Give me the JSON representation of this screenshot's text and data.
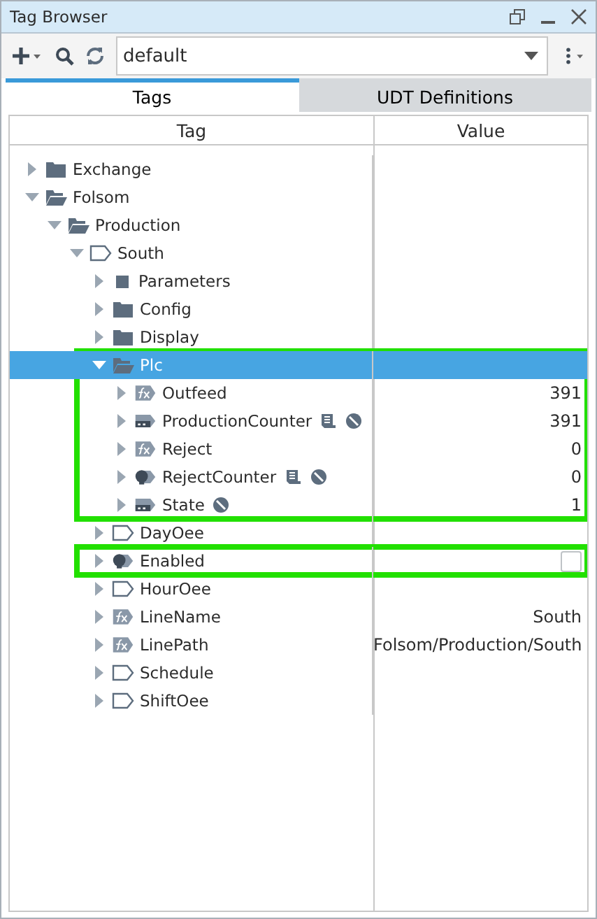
{
  "window": {
    "title": "Tag Browser"
  },
  "toolbar": {
    "provider": "default"
  },
  "tabs": [
    {
      "label": "Tags",
      "selected": true
    },
    {
      "label": "UDT Definitions",
      "selected": false
    }
  ],
  "table": {
    "columns": [
      "Tag",
      "Value"
    ],
    "tree": [
      {
        "name": "Exchange",
        "kind": "folder",
        "expanded": false,
        "selected": false
      },
      {
        "name": "Folsom",
        "kind": "folder",
        "expanded": true,
        "selected": false,
        "children": [
          {
            "name": "Production",
            "kind": "folder",
            "expanded": true,
            "selected": false,
            "children": [
              {
                "name": "South",
                "kind": "udt",
                "expanded": true,
                "selected": false,
                "children": [
                  {
                    "name": "Parameters",
                    "kind": "params",
                    "expanded": false,
                    "selected": false
                  },
                  {
                    "name": "Config",
                    "kind": "folder",
                    "expanded": false,
                    "selected": false
                  },
                  {
                    "name": "Display",
                    "kind": "folder",
                    "expanded": false,
                    "selected": false
                  },
                  {
                    "name": "Plc",
                    "kind": "folder",
                    "expanded": true,
                    "selected": true,
                    "highlighted": true,
                    "children": [
                      {
                        "name": "Outfeed",
                        "kind": "expression",
                        "expanded": false,
                        "selected": false,
                        "value": "391"
                      },
                      {
                        "name": "ProductionCounter",
                        "kind": "opc",
                        "expanded": false,
                        "selected": false,
                        "value": "391",
                        "badges": [
                          {
                            "kind": "doc"
                          },
                          {
                            "kind": "dial"
                          }
                        ]
                      },
                      {
                        "name": "Reject",
                        "kind": "expression",
                        "expanded": false,
                        "selected": false,
                        "value": "0"
                      },
                      {
                        "name": "RejectCounter",
                        "kind": "query",
                        "expanded": false,
                        "selected": false,
                        "value": "0",
                        "badges": [
                          {
                            "kind": "doc"
                          },
                          {
                            "kind": "dial"
                          }
                        ]
                      },
                      {
                        "name": "State",
                        "kind": "opc",
                        "expanded": false,
                        "selected": false,
                        "value": "1",
                        "badges": [
                          {
                            "kind": "dial"
                          }
                        ]
                      }
                    ]
                  },
                  {
                    "name": "DayOee",
                    "kind": "udt",
                    "expanded": false,
                    "selected": false
                  },
                  {
                    "name": "Enabled",
                    "kind": "query",
                    "expanded": false,
                    "selected": false,
                    "highlighted": true,
                    "checkbox": {
                      "checked": false
                    }
                  },
                  {
                    "name": "HourOee",
                    "kind": "udt",
                    "expanded": false,
                    "selected": false
                  },
                  {
                    "name": "LineName",
                    "kind": "expression",
                    "expanded": false,
                    "selected": false,
                    "value": "South"
                  },
                  {
                    "name": "LinePath",
                    "kind": "expression",
                    "expanded": false,
                    "selected": false,
                    "value": "Folsom/Production/South"
                  },
                  {
                    "name": "Schedule",
                    "kind": "udt",
                    "expanded": false,
                    "selected": false
                  },
                  {
                    "name": "ShiftOee",
                    "kind": "udt",
                    "expanded": false,
                    "selected": false
                  }
                ]
              }
            ]
          }
        ]
      }
    ]
  }
}
